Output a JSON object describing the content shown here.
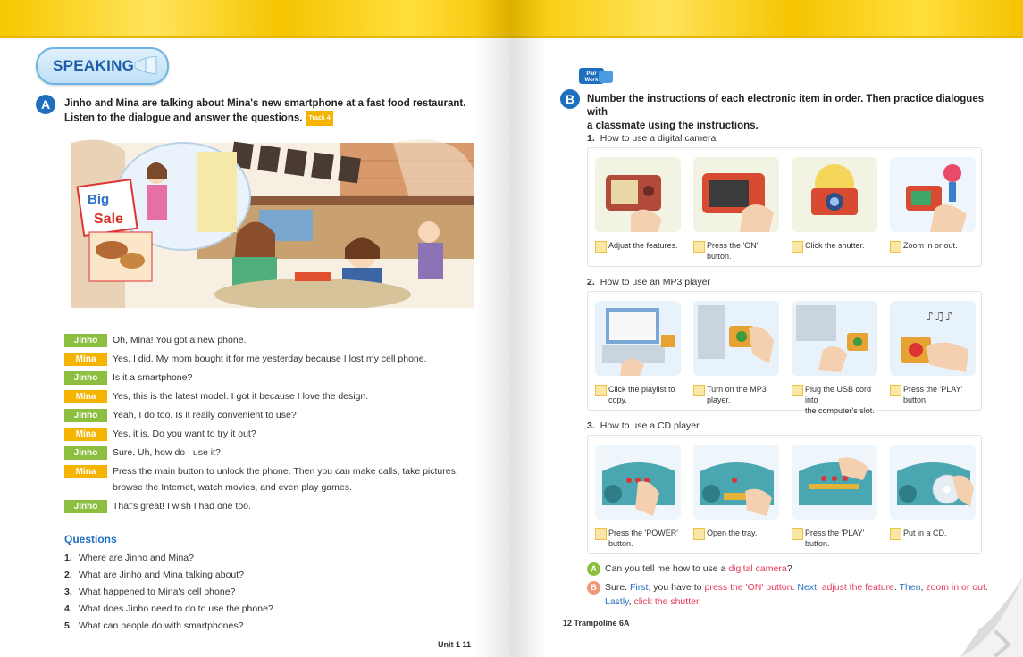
{
  "left": {
    "speaking_badge": "SPEAKING",
    "section_a": {
      "letter": "A",
      "instruction_line1": "Jinho and Mina are talking about Mina's new smartphone at a fast food restaurant.",
      "instruction_line2": "Listen to the dialogue and answer the questions.",
      "track": "Track 4"
    },
    "scene": {
      "sign_word1": "Big",
      "sign_word2": "Sale"
    },
    "dialogue": [
      {
        "speaker": "Jinho",
        "text": "Oh, Mina! You got a new phone."
      },
      {
        "speaker": "Mina",
        "text": "Yes, I did. My mom bought it for me yesterday because I lost my cell phone."
      },
      {
        "speaker": "Jinho",
        "text": "Is it a smartphone?"
      },
      {
        "speaker": "Mina",
        "text": "Yes, this is the latest model. I got it because I love the design."
      },
      {
        "speaker": "Jinho",
        "text": "Yeah, I do too. Is it really convenient to use?"
      },
      {
        "speaker": "Mina",
        "text": "Yes, it is. Do you want to try it out?"
      },
      {
        "speaker": "Jinho",
        "text": "Sure. Uh, how do I use it?"
      },
      {
        "speaker": "Mina",
        "text": "Press the main button to unlock the phone. Then you can make calls, take pictures,",
        "text2": "browse the Internet, watch movies, and even play games."
      },
      {
        "speaker": "Jinho",
        "text": "That's great! I wish I had one too."
      }
    ],
    "questions_title": "Questions",
    "questions": [
      {
        "num": "1.",
        "text": "Where are Jinho and Mina?"
      },
      {
        "num": "2.",
        "text": "What are Jinho and Mina talking about?"
      },
      {
        "num": "3.",
        "text": "What happened to Mina's cell phone?"
      },
      {
        "num": "4.",
        "text": "What does Jinho need to do to use the phone?"
      },
      {
        "num": "5.",
        "text": "What can people do with smartphones?"
      }
    ],
    "footer": "Unit 1   11"
  },
  "right": {
    "pair_work": {
      "line1": "Pair",
      "line2": "Work"
    },
    "section_b": {
      "letter": "B",
      "instruction_line1": "Number the instructions of each electronic item in order. Then practice dialogues with",
      "instruction_line2": "a classmate using the instructions."
    },
    "groups": [
      {
        "num": "1.",
        "title": "How to use a digital camera",
        "items": [
          [
            "Adjust the features.",
            ""
          ],
          [
            "Press the 'ON'",
            "button."
          ],
          [
            "Click the shutter.",
            ""
          ],
          [
            "Zoom in or out.",
            ""
          ]
        ]
      },
      {
        "num": "2.",
        "title": "How to use an MP3 player",
        "items": [
          [
            "Click the playlist to",
            "copy."
          ],
          [
            "Turn on the MP3",
            "player."
          ],
          [
            "Plug the USB cord into",
            "the computer's slot."
          ],
          [
            "Press the 'PLAY'",
            "button."
          ]
        ]
      },
      {
        "num": "3.",
        "title": "How to use a CD player",
        "items": [
          [
            "Press the 'POWER'",
            "button."
          ],
          [
            "Open the tray.",
            ""
          ],
          [
            "Press the 'PLAY'",
            "button."
          ],
          [
            "Put in a CD.",
            ""
          ]
        ]
      }
    ],
    "conversation": {
      "a_label": "A",
      "a_text": "Can you tell me how to use a ",
      "a_item": "digital camera",
      "a_end": "?",
      "b_label": "B",
      "b_sure": "Sure. ",
      "b_first": "First",
      "b_t1": ", you have to ",
      "b_s1": "press the 'ON' button",
      "b_t2": ". ",
      "b_next": "Next",
      "b_t3": ", ",
      "b_s2": "adjust the feature",
      "b_t4": ". ",
      "b_then": "Then",
      "b_t5": ", ",
      "b_s3": "zoom in or out",
      "b_t6": ".",
      "b_lastly": "Lastly",
      "b_t7": ", ",
      "b_s4": "click the shutter",
      "b_t8": "."
    },
    "footer": "12  Trampoline 6A"
  },
  "colors": {
    "accent_yellow": "#f7c800",
    "section_blue": "#1f6fbf",
    "jinho_green": "#8cbf3f",
    "mina_orange": "#f5b400",
    "highlight_red": "#e33b5b",
    "highlight_blue": "#2a6fc0"
  },
  "icons": [
    "megaphone-icon",
    "next-page-arrow-icon"
  ]
}
